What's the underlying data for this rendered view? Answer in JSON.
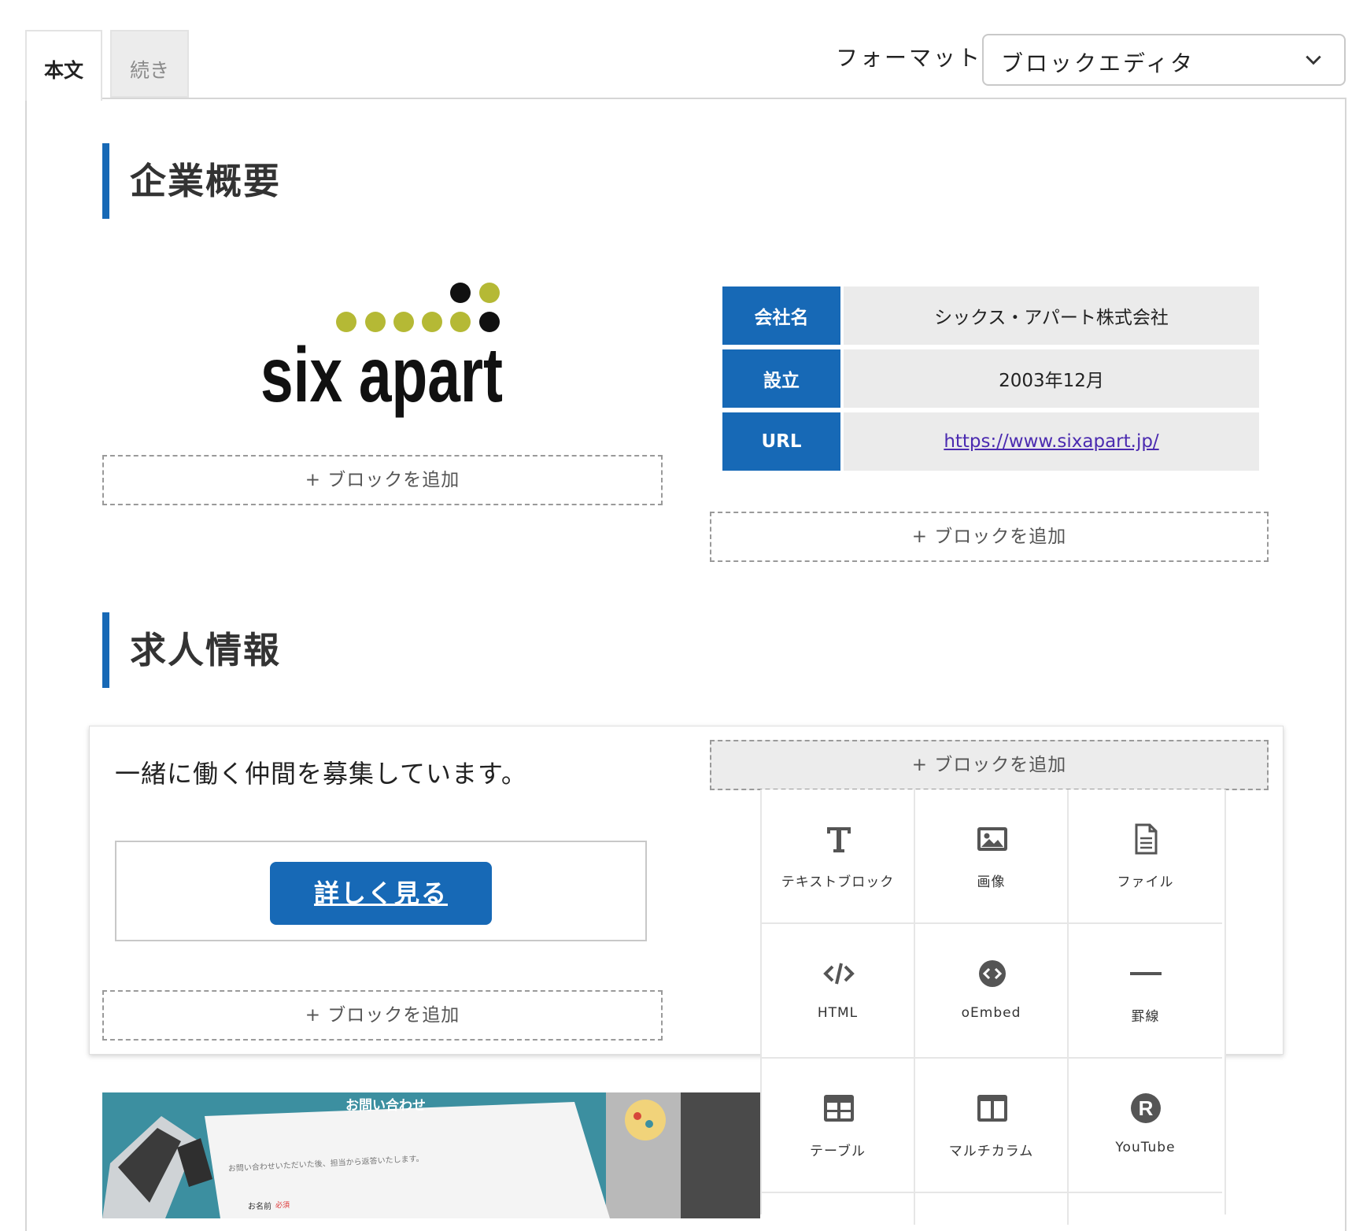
{
  "tabs": {
    "main": "本文",
    "more": "続き"
  },
  "format": {
    "label": "フォーマット:",
    "value": "ブロックエディタ",
    "icon": "chevron-down-icon"
  },
  "sections": {
    "company_heading": "企業概要",
    "job_heading": "求人情報"
  },
  "logo": {
    "text": "six apart",
    "icon": "six-apart-logo"
  },
  "company_table": [
    {
      "label": "会社名",
      "value": "シックス・アパート株式会社"
    },
    {
      "label": "設立",
      "value": "2003年12月"
    },
    {
      "label": "URL",
      "value": "https://www.sixapart.jp/"
    }
  ],
  "add_block_label": "+ ブロックを追加",
  "job": {
    "text": "一緒に働く仲間を募集しています。",
    "button": "詳しく見る"
  },
  "screenshot": {
    "title": "お問い合わせ",
    "body": "お問い合わせいただいた後、担当から返答いたします。",
    "field": "お名前",
    "required": "必須"
  },
  "palette": [
    {
      "label": "テキストブロック",
      "icon": "text-icon"
    },
    {
      "label": "画像",
      "icon": "image-icon"
    },
    {
      "label": "ファイル",
      "icon": "file-icon"
    },
    {
      "label": "HTML",
      "icon": "code-icon"
    },
    {
      "label": "oEmbed",
      "icon": "embed-icon"
    },
    {
      "label": "罫線",
      "icon": "horizontal-rule-icon"
    },
    {
      "label": "テーブル",
      "icon": "table-icon"
    },
    {
      "label": "マルチカラム",
      "icon": "columns-icon"
    },
    {
      "label": "YouTube",
      "icon": "youtube-icon"
    }
  ],
  "colors": {
    "accent": "#1769b6",
    "logo_green": "#b5b935",
    "link": "#4b2bb0"
  }
}
